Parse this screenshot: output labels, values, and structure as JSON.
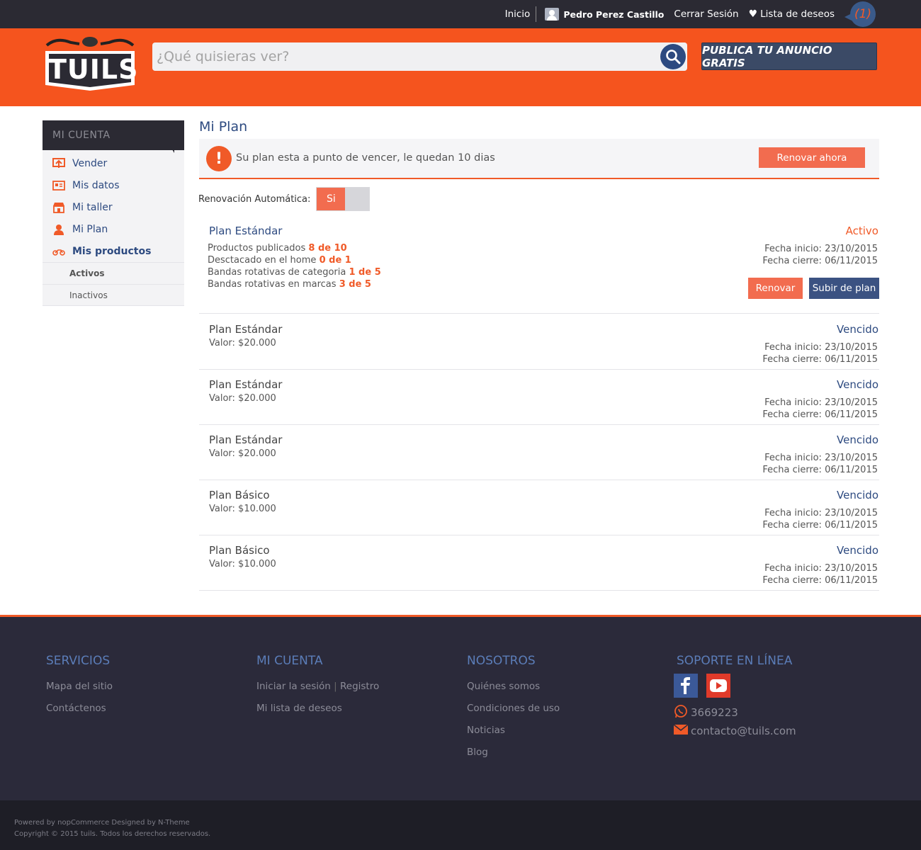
{
  "topbar": {
    "home": "Inicio",
    "user_name": "Pedro Perez Castillo",
    "logout": "Cerrar Sesión",
    "wishlist": "Lista de deseos",
    "wishlist_count": "(1)"
  },
  "header": {
    "logo_text": "TUILS",
    "search_placeholder": "¿Qué quisieras ver?",
    "publish_button": "PUBLICA TU ANUNCIO GRATIS"
  },
  "sidebar": {
    "heading": "MI CUENTA",
    "items": [
      {
        "label": "Vender",
        "icon": "upload-icon"
      },
      {
        "label": "Mis datos",
        "icon": "id-card-icon"
      },
      {
        "label": "Mi taller",
        "icon": "store-icon"
      },
      {
        "label": "Mi Plan",
        "icon": "user-icon"
      },
      {
        "label": "Mis productos",
        "icon": "motorcycle-icon"
      }
    ],
    "subitems": [
      "Activos",
      "Inactivos"
    ]
  },
  "main": {
    "title": "Mi Plan",
    "alert_text": "Su plan esta a punto de vencer, le quedan 10 dias",
    "renew_now": "Renovar ahora",
    "auto_renew_label": "Renovación Automática:",
    "auto_renew_value": "Si",
    "active_plan": {
      "name": "Plan Estándar",
      "status": "Activo",
      "details": [
        {
          "label": "Productos publicados",
          "value": "8 de 10"
        },
        {
          "label": "Desctacado en el home",
          "value": "0 de 1"
        },
        {
          "label": "Bandas rotativas de categoria",
          "value": "1 de 5"
        },
        {
          "label": "Bandas rotativas en marcas",
          "value": "3 de 5"
        }
      ],
      "start": "Fecha inicio: 23/10/2015",
      "end": "Fecha cierre: 06/11/2015",
      "renew_button": "Renovar",
      "upgrade_button": "Subir de plan"
    },
    "history": [
      {
        "name": "Plan Estándar",
        "value": "Valor: $20.000",
        "status": "Vencido",
        "start": "Fecha inicio: 23/10/2015",
        "end": "Fecha cierre: 06/11/2015"
      },
      {
        "name": "Plan Estándar",
        "value": "Valor: $20.000",
        "status": "Vencido",
        "start": "Fecha inicio: 23/10/2015",
        "end": "Fecha cierre: 06/11/2015"
      },
      {
        "name": "Plan Estándar",
        "value": "Valor: $20.000",
        "status": "Vencido",
        "start": "Fecha inicio: 23/10/2015",
        "end": "Fecha cierre: 06/11/2015"
      },
      {
        "name": "Plan Básico",
        "value": "Valor: $10.000",
        "status": "Vencido",
        "start": "Fecha inicio: 23/10/2015",
        "end": "Fecha cierre: 06/11/2015"
      },
      {
        "name": "Plan Básico",
        "value": "Valor: $10.000",
        "status": "Vencido",
        "start": "Fecha inicio: 23/10/2015",
        "end": "Fecha cierre: 06/11/2015"
      }
    ]
  },
  "footer": {
    "servicios": {
      "heading": "SERVICIOS",
      "links": [
        "Mapa del sitio",
        "Contáctenos"
      ]
    },
    "cuenta": {
      "heading": "MI CUENTA",
      "login": "Iniciar la sesión",
      "pipe": "|",
      "register": "Registro",
      "wishlist": "Mi lista de deseos"
    },
    "nosotros": {
      "heading": "NOSOTROS",
      "links": [
        "Quiénes somos",
        "Condiciones de uso",
        "Noticias",
        "Blog"
      ]
    },
    "soporte": {
      "heading": "SOPORTE EN LÍNEA",
      "phone": "3669223",
      "email": "contacto@tuils.com"
    },
    "powered": "Powered by nopCommerce Designed by N-Theme",
    "copyright": "Copyright © 2015 tuils. Todos los derechos reservados."
  },
  "colors": {
    "brand_orange": "#f5541e",
    "navy": "#2d4a80",
    "dark": "#2b2a33"
  }
}
